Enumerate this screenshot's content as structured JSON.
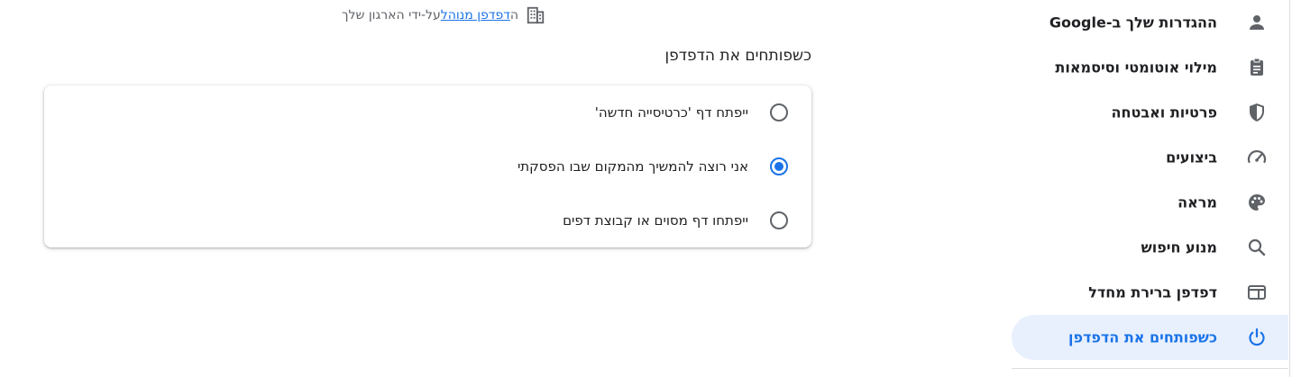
{
  "sidebar": {
    "items": [
      {
        "label": "ההגדרות שלך ב-Google",
        "icon": "person-icon",
        "active": false
      },
      {
        "label": "מילוי אוטומטי וסיסמאות",
        "icon": "clipboard-icon",
        "active": false
      },
      {
        "label": "פרטיות ואבטחה",
        "icon": "shield-icon",
        "active": false
      },
      {
        "label": "ביצועים",
        "icon": "speedometer-icon",
        "active": false
      },
      {
        "label": "מראה",
        "icon": "palette-icon",
        "active": false
      },
      {
        "label": "מנוע חיפוש",
        "icon": "search-icon",
        "active": false
      },
      {
        "label": "דפדפן ברירת מחדל",
        "icon": "browser-window-icon",
        "active": false
      },
      {
        "label": "כשפותחים את הדפדפן",
        "icon": "power-icon",
        "active": true
      }
    ]
  },
  "managed": {
    "prefix": "ה",
    "link": "דפדפן מנוהל",
    "suffix": " על-ידי הארגון שלך",
    "icon": "building-icon"
  },
  "startup": {
    "title": "כשפותחים את הדפדפן",
    "options": [
      {
        "label": "ייפתח דף 'כרטיסייה חדשה'",
        "checked": false
      },
      {
        "label": "אני רוצה להמשיך מהמקום שבו הפסקתי",
        "checked": true
      },
      {
        "label": "ייפתחו דף מסוים או קבוצת דפים",
        "checked": false
      }
    ]
  },
  "colors": {
    "accent": "#1a73e8",
    "active_bg": "#e8f0fe",
    "text": "#202124",
    "secondary_text": "#5f6368"
  }
}
